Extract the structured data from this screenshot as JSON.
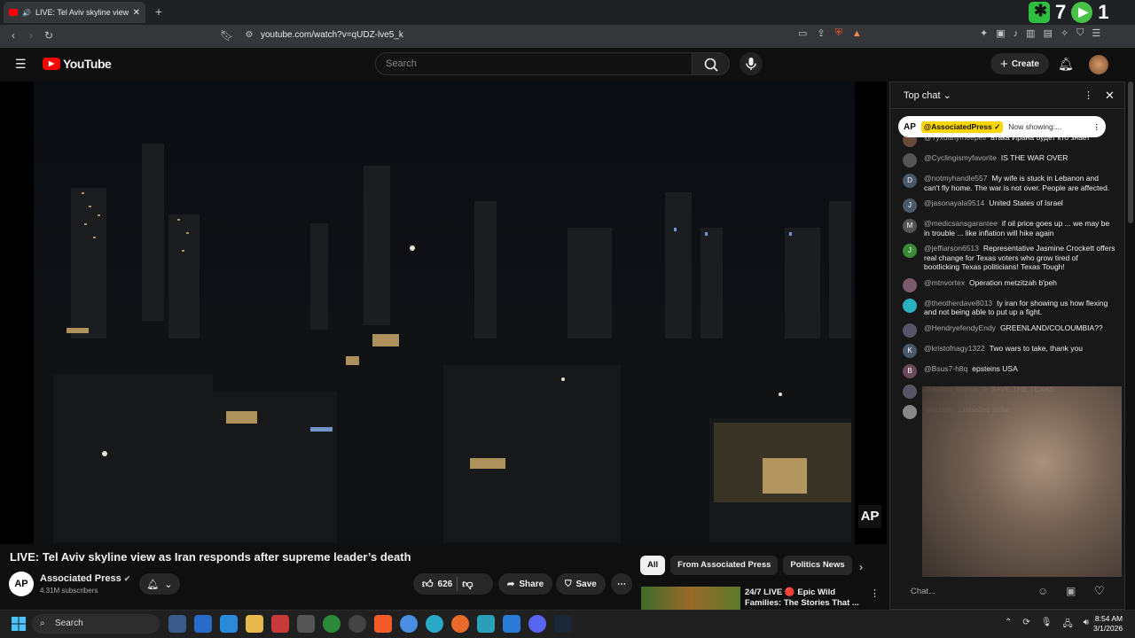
{
  "browser": {
    "tab_title": "LIVE: Tel Aviv skyline view as I",
    "new_tab": "+",
    "url": "youtube.com/watch?v=qUDZ-lve5_k",
    "ext_counter_1": "7",
    "ext_counter_2": "1"
  },
  "header": {
    "logo_text": "YouTube",
    "search_placeholder": "Search",
    "create_label": "Create"
  },
  "video": {
    "title": "LIVE: Tel Aviv skyline view as Iran responds after supreme leader’s death",
    "watermark": "AP",
    "channel": {
      "avatar": "AP",
      "name": "Associated Press",
      "subscribers": "4.31M subscribers"
    },
    "actions": {
      "likes": "626",
      "share": "Share",
      "save": "Save"
    }
  },
  "chips": [
    "All",
    "From Associated Press",
    "Politics News"
  ],
  "recommended": {
    "title": "24/7 LIVE 🔴 Epic Wild Families: The Stories That ..."
  },
  "chat": {
    "header": "Top chat",
    "pinned": {
      "avatar": "AP",
      "user": "@AssociatedPress ✓",
      "text": "Now showing:..."
    },
    "messages": [
      {
        "user": "@Tyxuanymeepeil",
        "text": "атака Ирана будет кто знает",
        "avatar": "",
        "color": "#6a4a3a"
      },
      {
        "user": "@Cyclingismyfavorite",
        "text": "IS THE WAR OVER",
        "avatar": "",
        "color": "#555"
      },
      {
        "user": "@notmyhandle557",
        "text": "My wife is stuck in Lebanon and can't fly home. The war is not over. People are affected.",
        "avatar": "D",
        "color": "#4a5a6a"
      },
      {
        "user": "@jasonayala9514",
        "text": "United States of Israel",
        "avatar": "J",
        "color": "#4a5a6a"
      },
      {
        "user": "@medicsansgarantee",
        "text": "if oil price goes up ... we may be in trouble ... like inflation will hike again",
        "avatar": "M",
        "color": "#555"
      },
      {
        "user": "@jeffiarson6513",
        "text": "Representative Jasmine Crockett offers real change for Texas voters who grow tired of bootlicking Texas politicians! Texas Tough!",
        "avatar": "J",
        "color": "#3a8a3a"
      },
      {
        "user": "@mtnvortex",
        "text": "Operation metzitzah b'peh",
        "avatar": "",
        "color": "#7a5a6a"
      },
      {
        "user": "@theotherdave8013",
        "text": "ty iran for showing us how flexing and not being able to put up a fight.",
        "avatar": "",
        "color": "#2ab0c0"
      },
      {
        "user": "@HendryefendyEndy",
        "text": "GREENLAND/COLOUMBIA??",
        "avatar": "",
        "color": "#556"
      },
      {
        "user": "@kristofnagy1322",
        "text": "Two wars to take, thank you",
        "avatar": "K",
        "color": "#4a5a6a"
      },
      {
        "user": "@Bsus7-h8q",
        "text": "epsteins USA",
        "avatar": "B",
        "color": "#6a4a5a"
      },
      {
        "user": "@Anton_Wijaya_8",
        "text": "SAVE THE TEXAS",
        "avatar": "",
        "color": "#556"
      },
      {
        "user": "@aurine",
        "text": "...missiles strike",
        "avatar": "",
        "color": "#888"
      }
    ],
    "input_placeholder": "Chat..."
  },
  "taskbar": {
    "search": "Search",
    "time": "8:54 AM",
    "date": "3/1/2026"
  }
}
